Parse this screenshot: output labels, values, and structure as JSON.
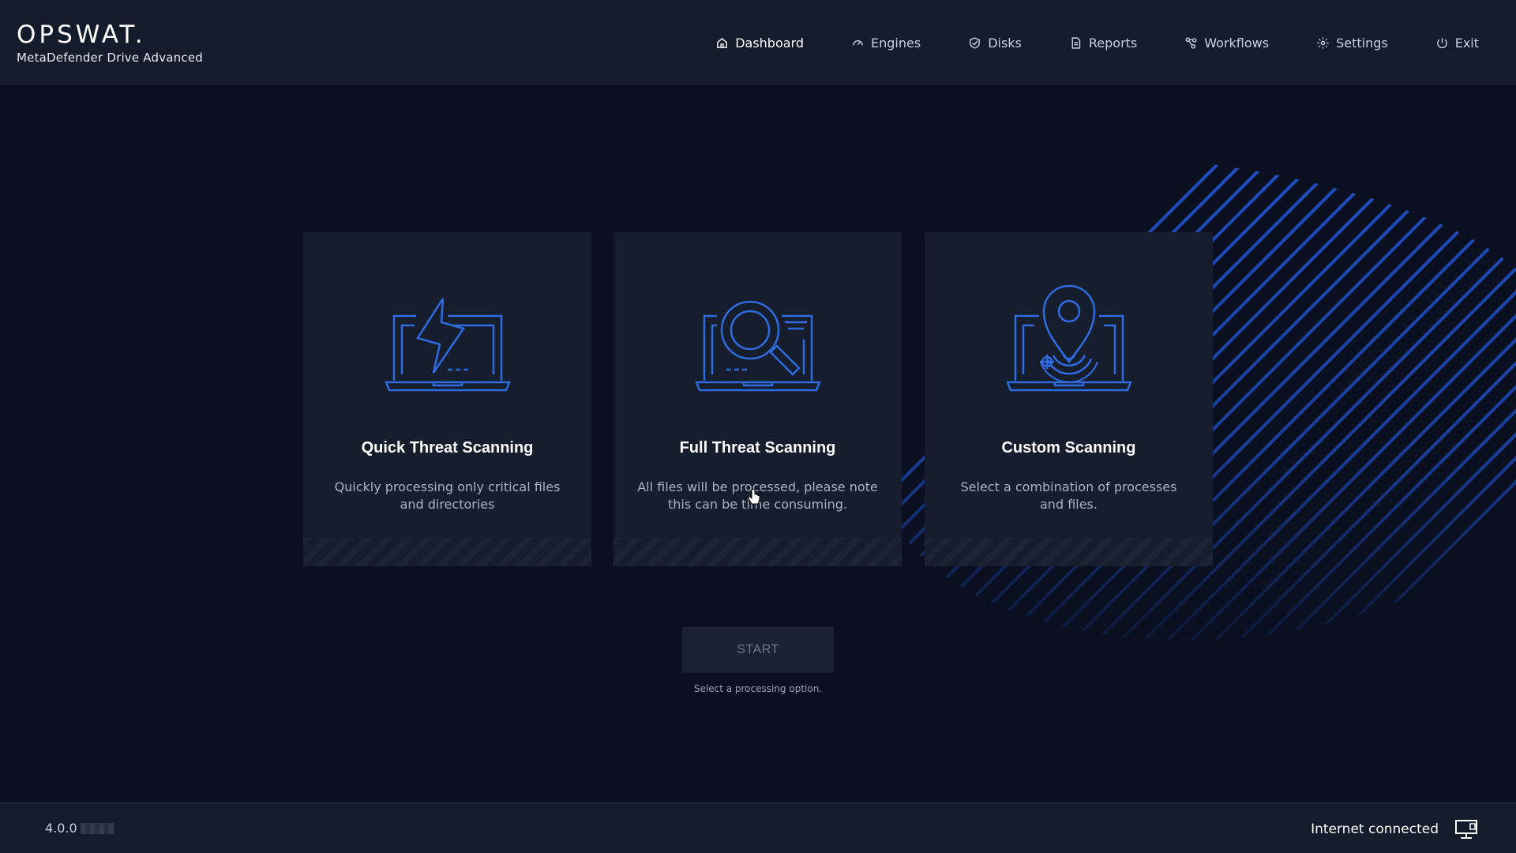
{
  "brand": {
    "logo": "OPSWAT.",
    "product": "MetaDefender Drive Advanced"
  },
  "nav": {
    "items": [
      {
        "label": "Dashboard",
        "icon": "home-icon",
        "active": true
      },
      {
        "label": "Engines",
        "icon": "gauge-icon",
        "active": false
      },
      {
        "label": "Disks",
        "icon": "shield-check-icon",
        "active": false
      },
      {
        "label": "Reports",
        "icon": "document-icon",
        "active": false
      },
      {
        "label": "Workflows",
        "icon": "workflow-icon",
        "active": false
      },
      {
        "label": "Settings",
        "icon": "gear-icon",
        "active": false
      },
      {
        "label": "Exit",
        "icon": "power-icon",
        "active": false
      }
    ]
  },
  "cards": [
    {
      "title": "Quick Threat Scanning",
      "description": "Quickly processing only critical files and directories",
      "icon": "laptop-lightning-icon"
    },
    {
      "title": "Full Threat Scanning",
      "description": "All files will be processed, please note this can be time consuming.",
      "icon": "laptop-magnifier-icon"
    },
    {
      "title": "Custom Scanning",
      "description": "Select a combination of processes and files.",
      "icon": "laptop-location-pin-icon"
    }
  ],
  "start": {
    "label": "START",
    "hint": "Select a processing option."
  },
  "footer": {
    "version": "4.0.0",
    "connection_status": "Internet connected",
    "connection_icon": "monitor-network-icon"
  },
  "colors": {
    "background": "#0a1020",
    "header": "#141b2b",
    "card": "#161e2e",
    "accent_blue": "#2f6be0",
    "stripe_blue": "#1d49b5"
  }
}
